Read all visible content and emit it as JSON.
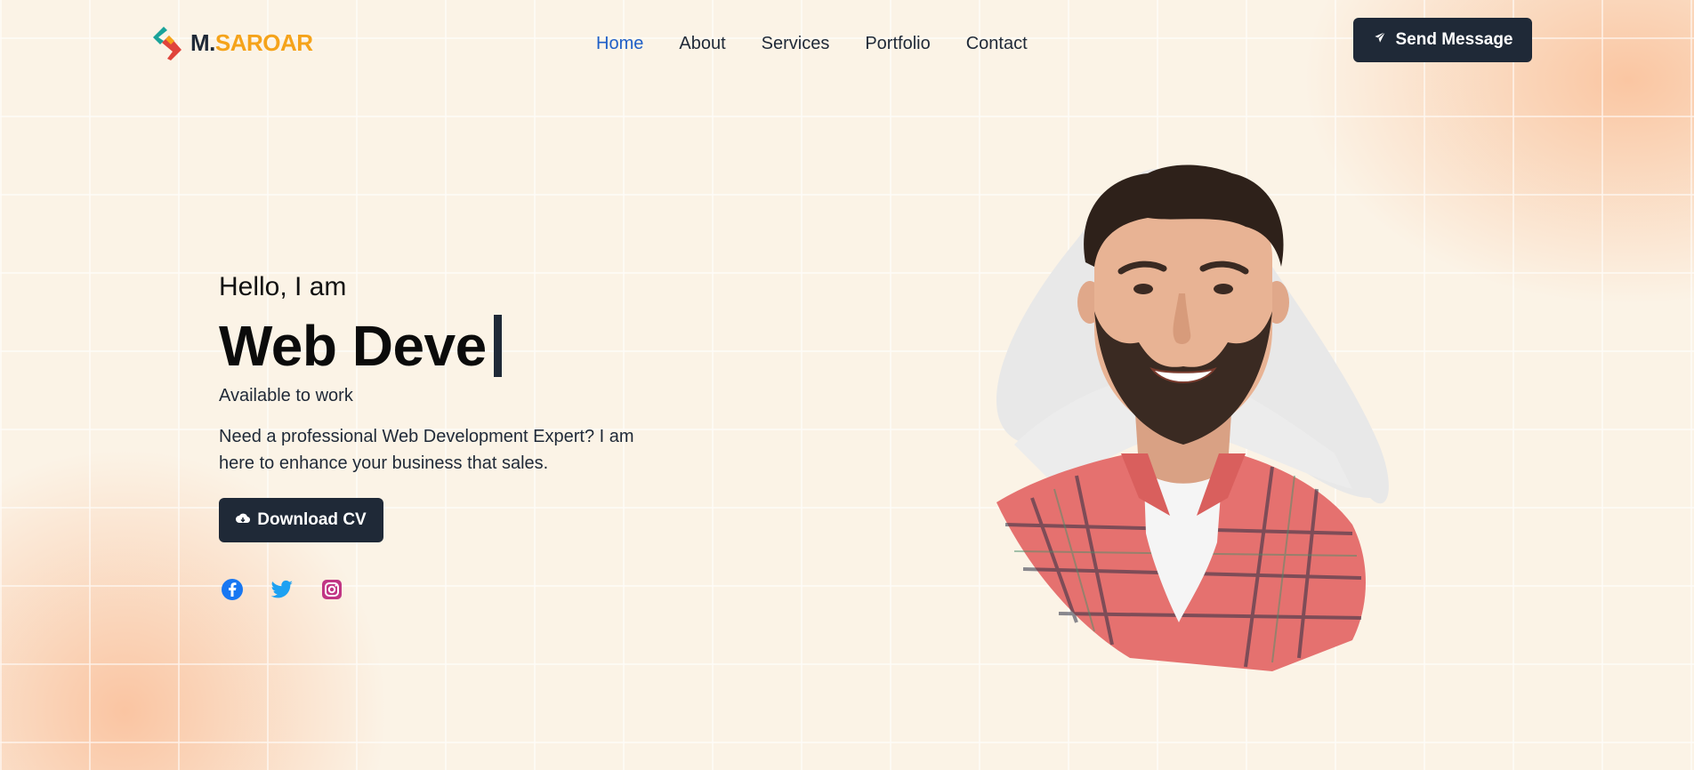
{
  "header": {
    "logo": {
      "prefix": "M.",
      "name": "SAROAR",
      "icon": "logo-chevron-icon"
    },
    "nav": [
      {
        "label": "Home",
        "active": true
      },
      {
        "label": "About",
        "active": false
      },
      {
        "label": "Services",
        "active": false
      },
      {
        "label": "Portfolio",
        "active": false
      },
      {
        "label": "Contact",
        "active": false
      }
    ],
    "cta": {
      "label": "Send Message",
      "icon": "paper-plane-icon"
    }
  },
  "hero": {
    "greeting": "Hello, I am",
    "typed_role": "Web Deve",
    "availability": "Available to work",
    "description": "Need a professional Web Development Expert? I am here to enhance your business that sales.",
    "download": {
      "label": "Download CV",
      "icon": "cloud-download-icon"
    },
    "socials": [
      {
        "name": "facebook",
        "icon": "facebook-icon",
        "color": "#1877f2"
      },
      {
        "name": "twitter",
        "icon": "twitter-icon",
        "color": "#1da1f2"
      },
      {
        "name": "instagram",
        "icon": "instagram-icon",
        "color": "#c13584"
      }
    ],
    "portrait": {
      "subject": "smiling bearded man in plaid shirt"
    }
  },
  "colors": {
    "accent": "#1f5fc7",
    "dark": "#1f2937",
    "logo_orange": "#f5a31a",
    "background": "#fbf3e6"
  }
}
